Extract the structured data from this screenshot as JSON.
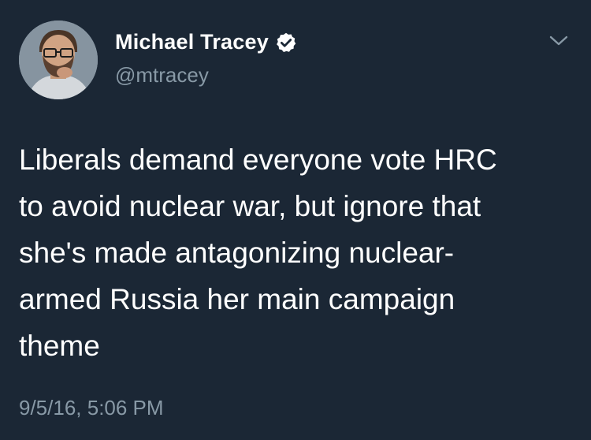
{
  "tweet": {
    "author": {
      "display_name": "Michael Tracey",
      "handle": "@mtracey",
      "verified": true,
      "verified_icon": "verified-badge-icon"
    },
    "text": "Liberals demand everyone vote HRC\nto avoid nuclear war, but ignore that\nshe's made antagonizing nuclear-\narmed Russia her main campaign\ntheme",
    "timestamp": "9/5/16, 5:06 PM",
    "menu_icon": "chevron-down-icon"
  },
  "colors": {
    "background": "#1b2735",
    "primary_text": "#ffffff",
    "secondary_text": "#8899a6"
  }
}
